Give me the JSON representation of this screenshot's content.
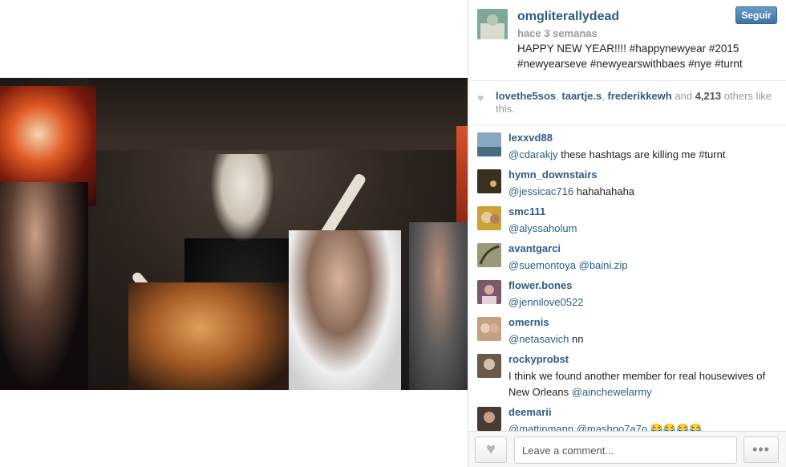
{
  "post": {
    "author": "omgliterallydead",
    "time": "hace 3 semanas",
    "caption": "HAPPY NEW YEAR!!!! #happynewyear #2015 #newyearseve #newyearswithbaes #nye #turnt",
    "follow_label": "Seguir",
    "avatar_color": "#7fa89a"
  },
  "likes": {
    "user1": "lovethe5sos",
    "sep1": ", ",
    "user2": "taartje.s",
    "sep2": ", ",
    "user3": "frederikkewh",
    "and": " and ",
    "count": "4,213",
    "tail": " others like this."
  },
  "comments": [
    {
      "user": "lexxvd88",
      "mention": "@cdarakjy",
      "text": " these hashtags are killing me #turnt",
      "avatar_color": "#8aa7c0"
    },
    {
      "user": "hymn_downstairs",
      "mention": "@jessicac716",
      "text": " hahahahaha",
      "avatar_color": "#3a3022"
    },
    {
      "user": "smc111",
      "mention": "@alyssaholum",
      "text": "",
      "avatar_color": "#c9a23a"
    },
    {
      "user": "avantgarci",
      "mention": "@suemontoya @baini.zip",
      "text": "",
      "avatar_color": "#9a9a7a"
    },
    {
      "user": "flower.bones",
      "mention": "@jennilove0522",
      "text": "",
      "avatar_color": "#7a5a6a"
    },
    {
      "user": "omernis",
      "mention": "@netasavich",
      "text": " nn",
      "avatar_color": "#c2a080"
    },
    {
      "user": "rockyprobst",
      "mention": "",
      "text": "I think we found another member for real housewives of New Orleans ",
      "mention_end": "@ainchewelarmy",
      "avatar_color": "#6a5a4a"
    },
    {
      "user": "deemarii",
      "mention": "@mattinmann @mashpo7a7o",
      "text": " 😂😂😂😂",
      "avatar_color": "#4a3a34"
    }
  ],
  "footer": {
    "comment_placeholder": "Leave a comment...",
    "heart_icon": "heart-icon",
    "more_icon": "more-options-icon"
  }
}
